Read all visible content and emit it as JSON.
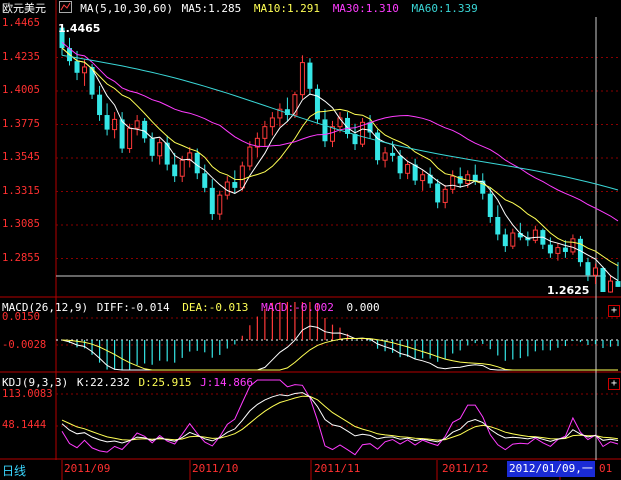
{
  "header": {
    "symbol": "欧元美元",
    "ma_title": "MA(5,10,30,60)",
    "ma5": "MA5:1.285",
    "ma10": "MA10:1.291",
    "ma30": "MA30:1.310",
    "ma60": "MA60:1.339"
  },
  "price_axis": [
    "1.4465",
    "1.4235",
    "1.4005",
    "1.3775",
    "1.3545",
    "1.3315",
    "1.3085",
    "1.2855"
  ],
  "high_marker": "1.4465",
  "last_marker": "1.2625",
  "macd": {
    "title": "MACD(26,12,9)",
    "diff": "DIFF:-0.014",
    "dea": "DEA:-0.013",
    "macd": "MACD:-0.002",
    "extra": "0.000",
    "axis": [
      "0.0150",
      "-0.0028"
    ]
  },
  "kdj": {
    "title": "KDJ(9,3,3)",
    "k": "K:22.232",
    "d": "D:25.915",
    "j": "J:14.866",
    "axis": [
      "113.0083",
      "48.1444"
    ]
  },
  "footer": {
    "period": "日线",
    "months": [
      "2011/09",
      "2011/10",
      "2011/11",
      "2011/12"
    ],
    "cursor_date": "2012/01/09,一",
    "cursor_tail": "01"
  },
  "buttons": {
    "plus": "+"
  },
  "colors": {
    "up": "#ff3a3a",
    "down": "#35e6e6",
    "ma5": "#ffffff",
    "ma10": "#ffff55",
    "ma30": "#ff3cff",
    "ma60": "#3ad6d6",
    "axis": "#ff3030"
  },
  "chart_data": [
    {
      "type": "candlestick",
      "title": "欧元美元",
      "ylim": [
        1.2625,
        1.4465
      ],
      "y_ticks": [
        1.4465,
        1.4235,
        1.4005,
        1.3775,
        1.3545,
        1.3315,
        1.3085,
        1.2855
      ],
      "x_months": [
        "2011/09",
        "2011/10",
        "2011/11",
        "2011/12",
        "2012/01"
      ],
      "candles_ohlc": [
        [
          1.444,
          1.4465,
          1.425,
          1.43
        ],
        [
          1.43,
          1.437,
          1.418,
          1.421
        ],
        [
          1.421,
          1.428,
          1.408,
          1.413
        ],
        [
          1.413,
          1.422,
          1.404,
          1.417
        ],
        [
          1.417,
          1.419,
          1.395,
          1.398
        ],
        [
          1.398,
          1.404,
          1.38,
          1.384
        ],
        [
          1.384,
          1.392,
          1.37,
          1.374
        ],
        [
          1.374,
          1.386,
          1.368,
          1.381
        ],
        [
          1.381,
          1.386,
          1.358,
          1.361
        ],
        [
          1.361,
          1.378,
          1.358,
          1.375
        ],
        [
          1.375,
          1.384,
          1.37,
          1.38
        ],
        [
          1.38,
          1.382,
          1.365,
          1.368
        ],
        [
          1.368,
          1.372,
          1.352,
          1.356
        ],
        [
          1.356,
          1.368,
          1.35,
          1.365
        ],
        [
          1.365,
          1.37,
          1.346,
          1.35
        ],
        [
          1.35,
          1.358,
          1.338,
          1.342
        ],
        [
          1.342,
          1.356,
          1.338,
          1.353
        ],
        [
          1.353,
          1.362,
          1.348,
          1.358
        ],
        [
          1.358,
          1.361,
          1.34,
          1.344
        ],
        [
          1.344,
          1.35,
          1.331,
          1.334
        ],
        [
          1.334,
          1.34,
          1.312,
          1.316
        ],
        [
          1.316,
          1.332,
          1.312,
          1.329
        ],
        [
          1.329,
          1.342,
          1.326,
          1.338
        ],
        [
          1.338,
          1.346,
          1.33,
          1.334
        ],
        [
          1.334,
          1.352,
          1.332,
          1.349
        ],
        [
          1.349,
          1.366,
          1.346,
          1.362
        ],
        [
          1.362,
          1.372,
          1.355,
          1.368
        ],
        [
          1.368,
          1.38,
          1.362,
          1.376
        ],
        [
          1.376,
          1.386,
          1.37,
          1.382
        ],
        [
          1.382,
          1.392,
          1.376,
          1.388
        ],
        [
          1.388,
          1.396,
          1.38,
          1.384
        ],
        [
          1.384,
          1.4,
          1.382,
          1.398
        ],
        [
          1.398,
          1.425,
          1.395,
          1.42
        ],
        [
          1.42,
          1.423,
          1.398,
          1.402
        ],
        [
          1.402,
          1.405,
          1.378,
          1.381
        ],
        [
          1.381,
          1.388,
          1.362,
          1.366
        ],
        [
          1.366,
          1.38,
          1.362,
          1.376
        ],
        [
          1.376,
          1.386,
          1.372,
          1.382
        ],
        [
          1.382,
          1.386,
          1.368,
          1.371
        ],
        [
          1.371,
          1.378,
          1.36,
          1.364
        ],
        [
          1.364,
          1.382,
          1.362,
          1.379
        ],
        [
          1.379,
          1.384,
          1.368,
          1.372
        ],
        [
          1.372,
          1.374,
          1.35,
          1.353
        ],
        [
          1.353,
          1.362,
          1.348,
          1.358
        ],
        [
          1.358,
          1.366,
          1.352,
          1.356
        ],
        [
          1.356,
          1.36,
          1.34,
          1.344
        ],
        [
          1.344,
          1.352,
          1.34,
          1.35
        ],
        [
          1.35,
          1.354,
          1.336,
          1.339
        ],
        [
          1.339,
          1.346,
          1.332,
          1.343
        ],
        [
          1.343,
          1.348,
          1.334,
          1.337
        ],
        [
          1.337,
          1.34,
          1.32,
          1.324
        ],
        [
          1.324,
          1.336,
          1.32,
          1.333
        ],
        [
          1.333,
          1.346,
          1.33,
          1.342
        ],
        [
          1.342,
          1.348,
          1.334,
          1.337
        ],
        [
          1.337,
          1.346,
          1.334,
          1.343
        ],
        [
          1.343,
          1.35,
          1.336,
          1.339
        ],
        [
          1.339,
          1.344,
          1.326,
          1.33
        ],
        [
          1.33,
          1.334,
          1.31,
          1.314
        ],
        [
          1.314,
          1.322,
          1.298,
          1.302
        ],
        [
          1.302,
          1.306,
          1.29,
          1.294
        ],
        [
          1.294,
          1.306,
          1.292,
          1.303
        ],
        [
          1.303,
          1.31,
          1.298,
          1.3
        ],
        [
          1.3,
          1.304,
          1.294,
          1.298
        ],
        [
          1.298,
          1.308,
          1.296,
          1.305
        ],
        [
          1.305,
          1.306,
          1.292,
          1.295
        ],
        [
          1.295,
          1.3,
          1.286,
          1.289
        ],
        [
          1.289,
          1.296,
          1.284,
          1.293
        ],
        [
          1.293,
          1.298,
          1.286,
          1.29
        ],
        [
          1.29,
          1.302,
          1.288,
          1.299
        ],
        [
          1.299,
          1.301,
          1.28,
          1.283
        ],
        [
          1.283,
          1.286,
          1.27,
          1.274
        ],
        [
          1.274,
          1.282,
          1.268,
          1.279
        ],
        [
          1.279,
          1.28,
          1.263,
          1.2625
        ],
        [
          1.2625,
          1.274,
          1.262,
          1.27
        ],
        [
          1.27,
          1.283,
          1.266,
          1.266
        ]
      ]
    }
  ]
}
